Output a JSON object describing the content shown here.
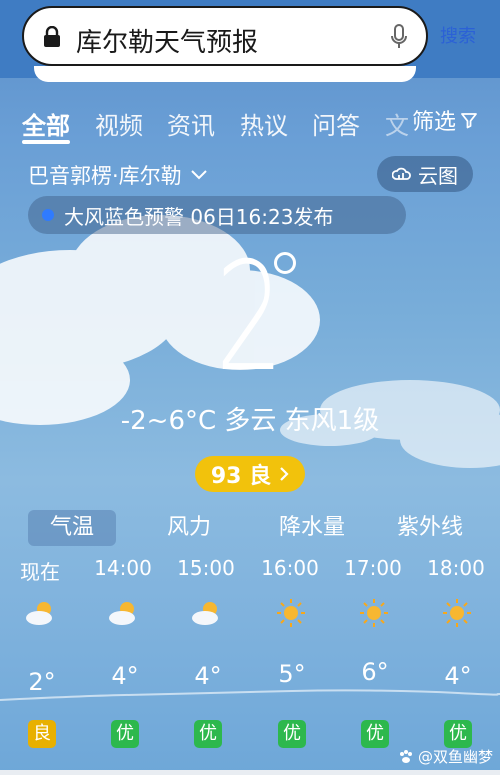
{
  "search": {
    "query": "库尔勒天气预报",
    "button_label": "搜索"
  },
  "tabs": {
    "items": [
      "全部",
      "视频",
      "资讯",
      "热议",
      "问答",
      "文"
    ],
    "filter_label": "筛选"
  },
  "location": {
    "label": "巴音郭楞·库尔勒",
    "cloudmap_label": "云图"
  },
  "alert": {
    "text": "大风蓝色预警 06日16:23发布"
  },
  "current": {
    "temp": "2",
    "summary": "-2~6°C 多云 东风1级",
    "aqi_label": "93 良"
  },
  "metric_tabs": [
    "气温",
    "风力",
    "降水量",
    "紫外线"
  ],
  "hourly": [
    {
      "time": "现在",
      "icon": "partly-cloudy-icon",
      "temp": "2",
      "aqi": "良",
      "aqi_color": "#e8b000"
    },
    {
      "time": "14:00",
      "icon": "partly-cloudy-icon",
      "temp": "4",
      "aqi": "优",
      "aqi_color": "#2db84d"
    },
    {
      "time": "15:00",
      "icon": "partly-cloudy-icon",
      "temp": "4",
      "aqi": "优",
      "aqi_color": "#2db84d"
    },
    {
      "time": "16:00",
      "icon": "sun-icon",
      "temp": "5",
      "aqi": "优",
      "aqi_color": "#2db84d"
    },
    {
      "time": "17:00",
      "icon": "sun-icon",
      "temp": "6",
      "aqi": "优",
      "aqi_color": "#2db84d"
    },
    {
      "time": "18:00",
      "icon": "sun-icon",
      "temp": "4",
      "aqi": "优",
      "aqi_color": "#2db84d"
    }
  ],
  "watermark": "@双鱼幽梦",
  "colors": {
    "aqi_good": "#f2c20c",
    "link": "#2b61d6",
    "alert_dot": "#2f7bff"
  }
}
